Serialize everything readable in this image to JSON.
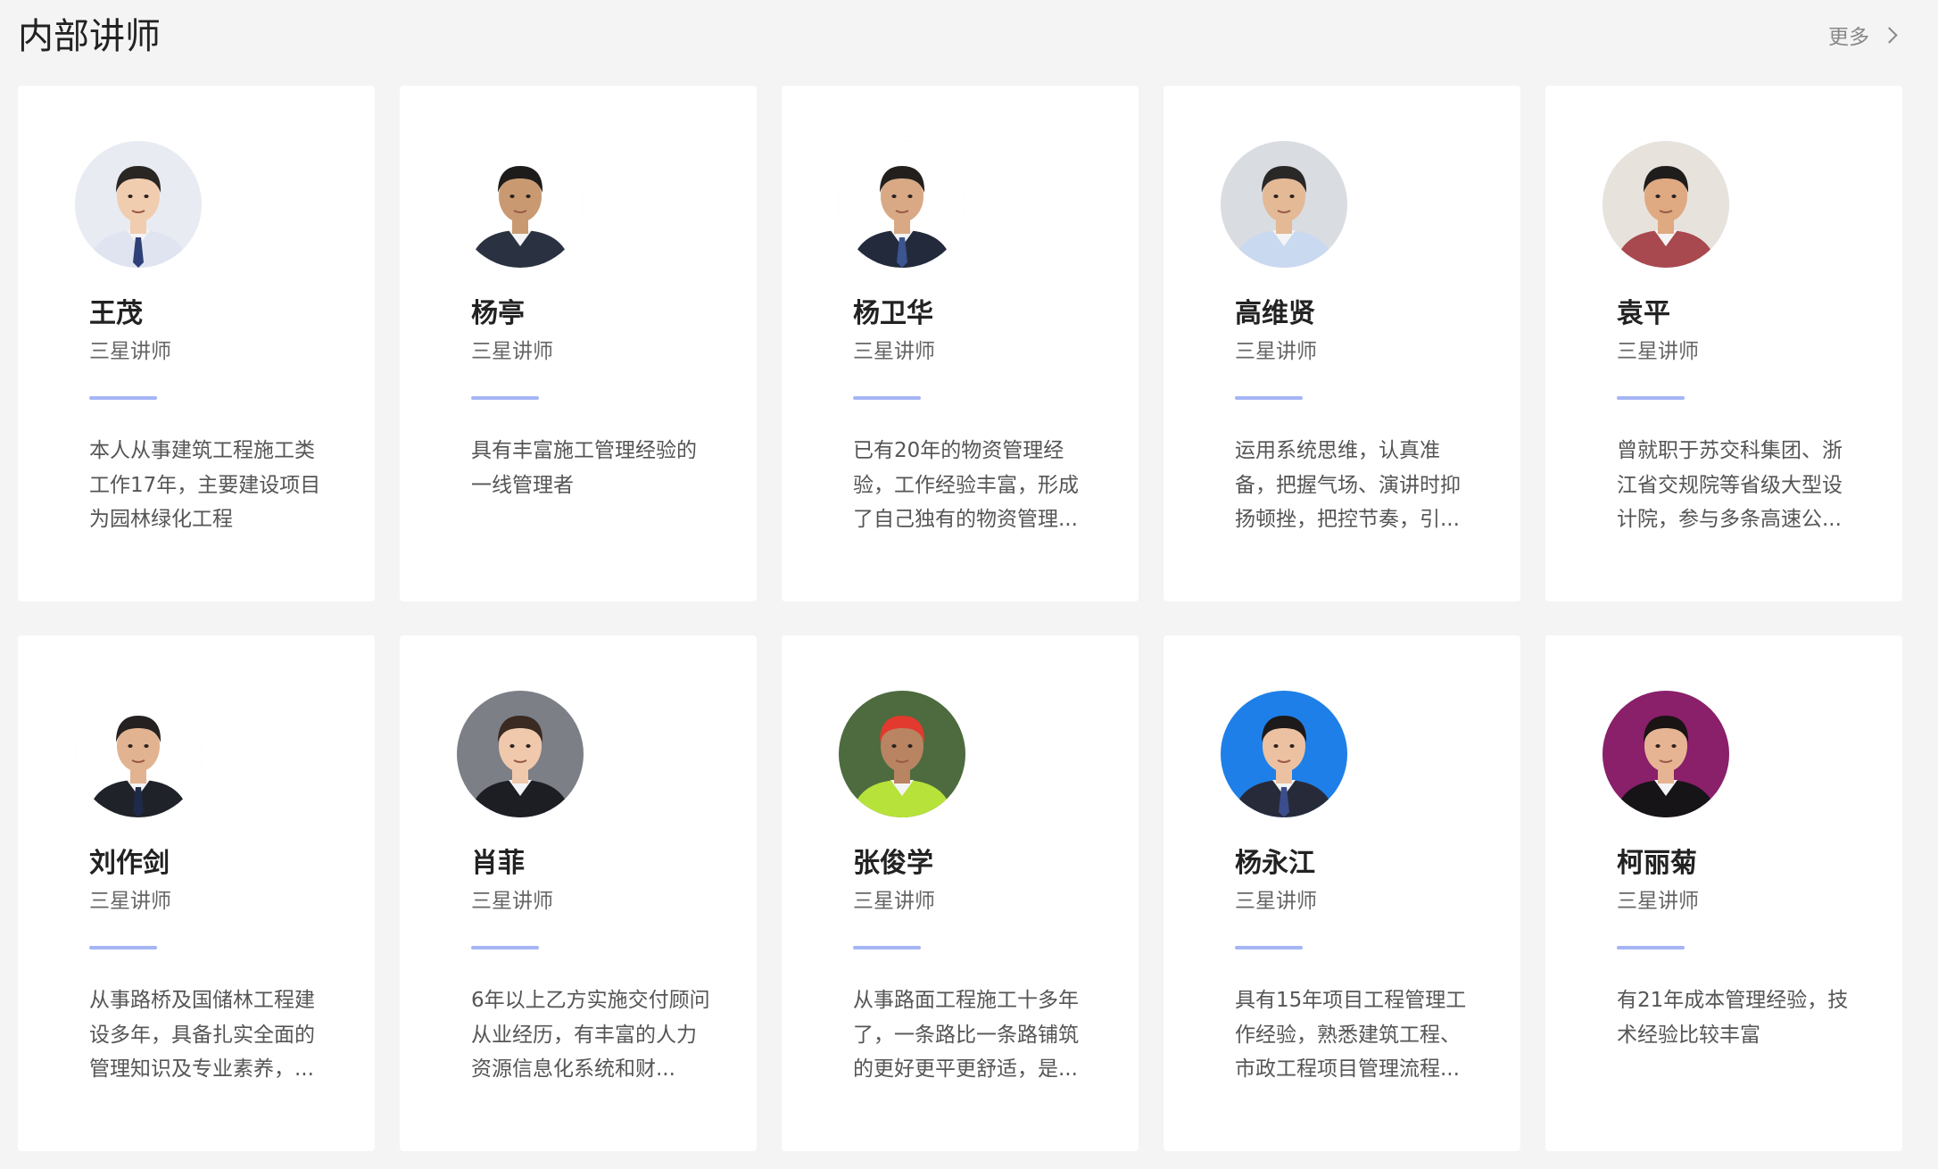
{
  "header": {
    "title": "内部讲师",
    "more_label": "更多"
  },
  "teachers": [
    {
      "name": "王茂",
      "level": "三星讲师",
      "desc": "本人从事建筑工程施工类工作17年，主要建设项目为园林绿化工程",
      "avatar": {
        "bg": "#e8ecf2",
        "skin": "#f1cdb0",
        "hair": "#2a2623",
        "clothes": "#dfe4f0",
        "tie": "#2f3f77"
      }
    },
    {
      "name": "杨亭",
      "level": "三星讲师",
      "desc": "具有丰富施工管理经验的一线管理者",
      "avatar": {
        "bg": "#ffffff",
        "skin": "#c99a72",
        "hair": "#1e1c1b",
        "clothes": "#2a3140",
        "tie": ""
      }
    },
    {
      "name": "杨卫华",
      "level": "三星讲师",
      "desc": "已有20年的物资管理经验，工作经验丰富，形成了自己独有的物资管理...",
      "avatar": {
        "bg": "#ffffff",
        "skin": "#d9a985",
        "hair": "#231f1d",
        "clothes": "#232a3c",
        "tie": "#3a5590"
      }
    },
    {
      "name": "高维贤",
      "level": "三星讲师",
      "desc": "运用系统思维，认真准备，把握气场、演讲时抑扬顿挫，把控节奏，引...",
      "avatar": {
        "bg": "#d9dce1",
        "skin": "#e3b996",
        "hair": "#2a2827",
        "clothes": "#c9d9ef",
        "tie": ""
      }
    },
    {
      "name": "袁平",
      "level": "三星讲师",
      "desc": "曾就职于苏交科集团、浙江省交规院等省级大型设计院，参与多条高速公...",
      "avatar": {
        "bg": "#e7e2dc",
        "skin": "#dfa982",
        "hair": "#1f1d1c",
        "clothes": "#a8484f",
        "tie": ""
      }
    },
    {
      "name": "刘作剑",
      "level": "三星讲师",
      "desc": "从事路桥及国储林工程建设多年，具备扎实全面的管理知识及专业素养，...",
      "avatar": {
        "bg": "#ffffff",
        "skin": "#e2b391",
        "hair": "#242120",
        "clothes": "#1f2229",
        "tie": "#1f2a4a"
      }
    },
    {
      "name": "肖菲",
      "level": "三星讲师",
      "desc": "6年以上乙方实施交付顾问从业经历，有丰富的人力资源信息化系统和财...",
      "avatar": {
        "bg": "#7c7f86",
        "skin": "#f0c9ad",
        "hair": "#3a2a22",
        "clothes": "#1d1e24",
        "tie": ""
      }
    },
    {
      "name": "张俊学",
      "level": "三星讲师",
      "desc": "从事路面工程施工十多年了，一条路比一条路铺筑的更好更平更舒适，是...",
      "avatar": {
        "bg": "#4d6b3e",
        "skin": "#b98462",
        "hair": "#e23a2e",
        "clothes": "#b6e23a",
        "tie": ""
      }
    },
    {
      "name": "杨永江",
      "level": "三星讲师",
      "desc": "具有15年项目工程管理工作经验，熟悉建筑工程、市政工程项目管理流程...",
      "avatar": {
        "bg": "#1f7fe8",
        "skin": "#ecc1a1",
        "hair": "#1c1a1a",
        "clothes": "#272b39",
        "tie": "#3b4d8c"
      }
    },
    {
      "name": "柯丽菊",
      "level": "三星讲师",
      "desc": "有21年成本管理经验，技术经验比较丰富",
      "avatar": {
        "bg": "#8a1f6a",
        "skin": "#e6b493",
        "hair": "#1a1414",
        "clothes": "#161417",
        "tie": ""
      }
    }
  ]
}
